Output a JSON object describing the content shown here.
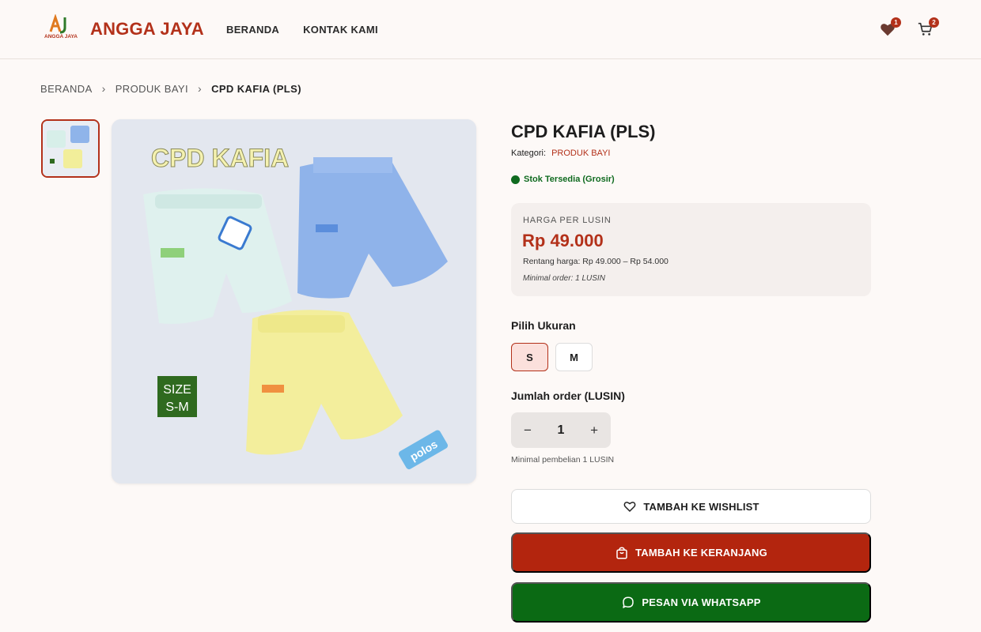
{
  "header": {
    "logo_text": "AJ",
    "logo_subtext": "ANGGA JAYA",
    "brand": "ANGGA JAYA",
    "nav": [
      "BERANDA",
      "KONTAK KAMI"
    ],
    "wishlist_count": "1",
    "cart_count": "2"
  },
  "breadcrumb": {
    "items": [
      "BERANDA",
      "PRODUK BAYI"
    ],
    "current": "CPD KAFIA (PLS)"
  },
  "gallery": {
    "image_title": "CPD KAFIA",
    "size_tag_line1": "SIZE",
    "size_tag_line2": "S-M",
    "polos_tag": "polos"
  },
  "product": {
    "title": "CPD KAFIA (PLS)",
    "category_label": "Kategori:",
    "category_value": "PRODUK BAYI",
    "stock": "Stok Tersedia (Grosir)",
    "price_label": "HARGA PER LUSIN",
    "price": "Rp 49.000",
    "price_range": "Rentang harga: Rp 49.000 – Rp 54.000",
    "min_order": "Minimal order: 1 LUSIN"
  },
  "size": {
    "title": "Pilih Ukuran",
    "options": [
      "S",
      "M"
    ],
    "selected": "S"
  },
  "quantity": {
    "title": "Jumlah order (LUSIN)",
    "minus": "−",
    "plus": "+",
    "value": "1",
    "min_note": "Minimal pembelian 1 LUSIN"
  },
  "actions": {
    "wishlist": "TAMBAH KE WISHLIST",
    "cart": "TAMBAH KE KERANJANG",
    "whatsapp": "PESAN VIA WHATSAPP"
  },
  "colors": {
    "brand": "#b3311a",
    "cart_button": "#b3250e",
    "whatsapp_button": "#0b6a14",
    "stock": "#0f6a1f"
  }
}
